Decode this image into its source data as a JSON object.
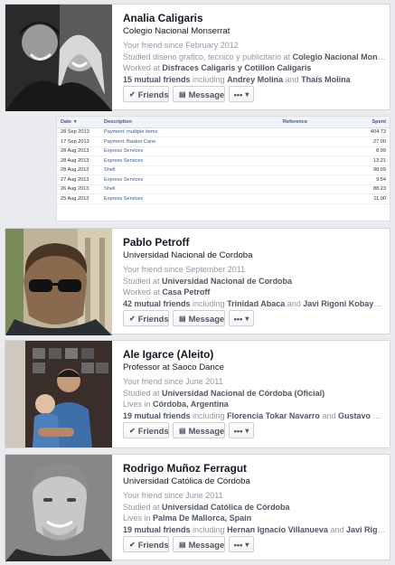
{
  "colors": {
    "link": "#3b5998",
    "muted": "#9197a3",
    "text": "#141823",
    "border": "#d3d6db"
  },
  "buttons": {
    "friends": "Friends",
    "message": "Message",
    "more": "•••"
  },
  "icons": {
    "friends_check": "check-icon",
    "message": "message-icon",
    "more_caret": "caret-down-icon"
  },
  "friends": [
    {
      "name": "Analia Caligaris",
      "subtitle": "Colegio Nacional Monserrat",
      "since": "Your friend since February 2012",
      "line2_prefix": "Studied diseno grafico, tecnico y publicitario at ",
      "line2_bold": "Colegio Nacional Monse...",
      "line3_prefix": "Worked at ",
      "line3_bold": "Disfraces Caligaris y Cotillon Caligaris",
      "mutual": "15 mutual friends",
      "mutual_including": " including ",
      "mutual_names": "Andrey Molina",
      "mutual_and": " and ",
      "mutual_names2": "Thaís Molina"
    },
    {
      "name": "Pablo Petroff",
      "subtitle": "Universidad Nacional de Cordoba",
      "since": "Your friend since September 2011",
      "line2_prefix": "Studied at ",
      "line2_bold": "Universidad Nacional de Cordoba",
      "line3_prefix": "Worked at ",
      "line3_bold": "Casa Petroff",
      "mutual": "42 mutual friends",
      "mutual_including": " including ",
      "mutual_names": "Trinidad Abaca",
      "mutual_and": " and ",
      "mutual_names2": "Javi Rigoni Kobayashi"
    },
    {
      "name": "Ale Igarce (Aleito)",
      "subtitle": "Professor at Saoco Dance",
      "since": "Your friend since June 2011",
      "line2_prefix": "Studied at ",
      "line2_bold": "Universidad Nacional de Córdoba (Oficial)",
      "line3_prefix": "Lives in ",
      "line3_bold": "Córdoba, Argentina",
      "mutual": "19 mutual friends",
      "mutual_including": " including ",
      "mutual_names": "Florencia Tokar Navarro",
      "mutual_and": " and ",
      "mutual_names2": "Gustavo Ga..."
    },
    {
      "name": "Rodrigo Muñoz Ferragut",
      "subtitle": "Universidad Católica de Córdoba",
      "since": "Your friend since June 2011",
      "line2_prefix": "Studied at ",
      "line2_bold": "Universidad Católica de Córdoba",
      "line3_prefix": "Lives in ",
      "line3_bold": "Palma De Mallorca, Spain",
      "mutual": "19 mutual friends",
      "mutual_including": " including ",
      "mutual_names": "Hernan Ignacio Villanueva",
      "mutual_and": " and ",
      "mutual_names2": "Javi Rigoni..."
    }
  ],
  "transactions": {
    "headers": {
      "date": "Date",
      "description": "Description",
      "reference": "Reference",
      "spent": "Spent"
    },
    "rows": [
      {
        "date": "28 Sep 2013",
        "description": "Payment: multiple items",
        "reference": "",
        "spent": "404.73"
      },
      {
        "date": "17 Sep 2013",
        "description": "Payment: Basket Cane",
        "reference": "",
        "spent": "27.00"
      },
      {
        "date": "28 Aug 2013",
        "description": "Express Services",
        "reference": "",
        "spent": "8.99"
      },
      {
        "date": "28 Aug 2013",
        "description": "Express Services",
        "reference": "",
        "spent": "13.21"
      },
      {
        "date": "28 Aug 2013",
        "description": "Shell",
        "reference": "",
        "spent": "98.09"
      },
      {
        "date": "27 Aug 2013",
        "description": "Express Services",
        "reference": "",
        "spent": "9.54"
      },
      {
        "date": "26 Aug 2013",
        "description": "Shell",
        "reference": "",
        "spent": "88.23"
      },
      {
        "date": "25 Aug 2013",
        "description": "Express Services",
        "reference": "",
        "spent": "11.90"
      }
    ]
  }
}
